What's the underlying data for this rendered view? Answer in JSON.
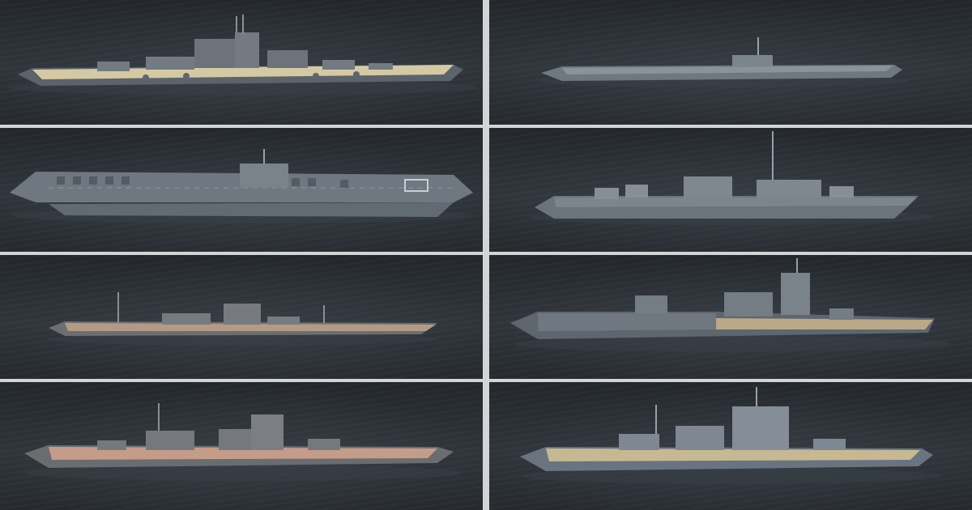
{
  "gallery": {
    "tiles": [
      {
        "ship": "battleship",
        "hull": "#5d636a",
        "deck": "#d4c9a4",
        "superstructure": "#737a82"
      },
      {
        "ship": "submarine",
        "hull": "#6f7780",
        "deck": "#8a929a",
        "superstructure": "#7c848c"
      },
      {
        "ship": "aircraft-carrier",
        "hull": "#626a72",
        "deck": "#6f7780",
        "superstructure": "#7a828a"
      },
      {
        "ship": "destroyer",
        "hull": "#6b737c",
        "deck": "#7c848d",
        "superstructure": "#868e96"
      },
      {
        "ship": "submarine-cruiser",
        "hull": "#6c6e72",
        "deck": "#b39a86",
        "superstructure": "#777b80"
      },
      {
        "ship": "hybrid-battleship-carrier",
        "hull": "#5f666e",
        "deck": "#b9a98a",
        "superstructure": "#747c84"
      },
      {
        "ship": "battlecruiser",
        "hull": "#6a6c70",
        "deck": "#c49c8a",
        "superstructure": "#75797e"
      },
      {
        "ship": "battleship",
        "hull": "#6a7480",
        "deck": "#c7b894",
        "superstructure": "#7e8792"
      }
    ]
  }
}
